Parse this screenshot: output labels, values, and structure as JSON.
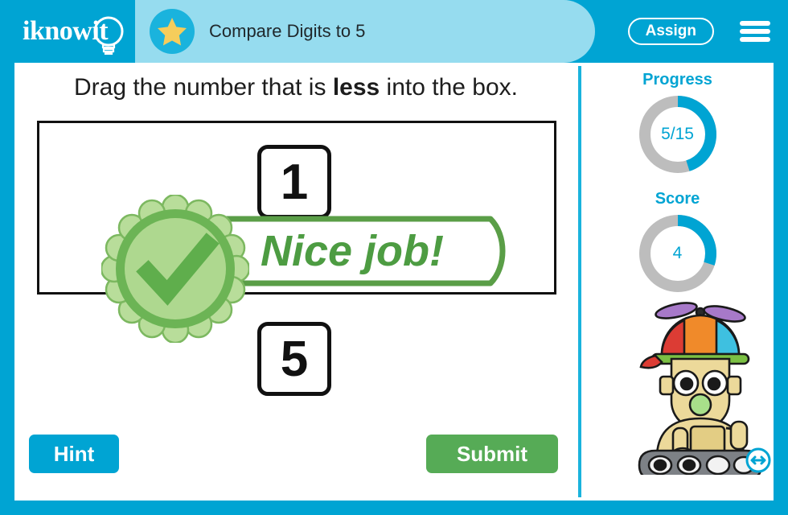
{
  "header": {
    "logo_text": "iknowit",
    "logo_icon": "lightbulb-icon",
    "star_icon": "star-icon",
    "lesson_title": "Compare Digits to 5",
    "assign_label": "Assign",
    "menu_icon": "hamburger-menu-icon"
  },
  "main": {
    "question_prefix": "Drag the number that is ",
    "question_emphasis": "less",
    "question_suffix": " into the box.",
    "cards": [
      {
        "value": "1",
        "position": "top"
      },
      {
        "value": "5",
        "position": "bottom"
      }
    ],
    "feedback": {
      "message": "Nice job!",
      "icon": "check-seal-icon",
      "color": "#4d9c42"
    },
    "hint_label": "Hint",
    "submit_label": "Submit"
  },
  "sidebar": {
    "progress": {
      "label": "Progress",
      "value": "5/15",
      "completed": 5,
      "total": 15,
      "percent": 45
    },
    "score": {
      "label": "Score",
      "value": "4",
      "percent": 30
    },
    "mascot_icon": "robot-mascot-icon",
    "resize_icon": "resize-horizontal-icon"
  },
  "colors": {
    "brand_blue": "#00a4d3",
    "banner_blue": "#96dcef",
    "accent_blue": "#1ab3dd",
    "success_green": "#56ab56",
    "feedback_green": "#4d9c42",
    "ring_track": "#bdbdbd",
    "star_gold": "#f5cd5b"
  }
}
